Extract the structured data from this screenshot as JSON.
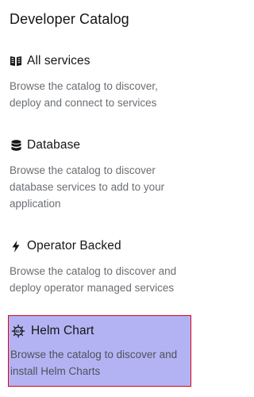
{
  "catalog": {
    "title": "Developer Catalog"
  },
  "cards": [
    {
      "icon": "book-icon",
      "title": "All services",
      "description": "Browse the catalog to discover, deploy and connect to services"
    },
    {
      "icon": "database-icon",
      "title": "Database",
      "description": "Browse the catalog to discover database services to add to your application"
    },
    {
      "icon": "bolt-icon",
      "title": "Operator Backed",
      "description": "Browse the catalog to discover and deploy operator managed services"
    },
    {
      "icon": "helm-icon",
      "title": "Helm Chart",
      "description": "Browse the catalog to discover and install Helm Charts",
      "selected": true,
      "highlight_color": "#b3b3f4",
      "border_color": "#d9001b"
    }
  ]
}
